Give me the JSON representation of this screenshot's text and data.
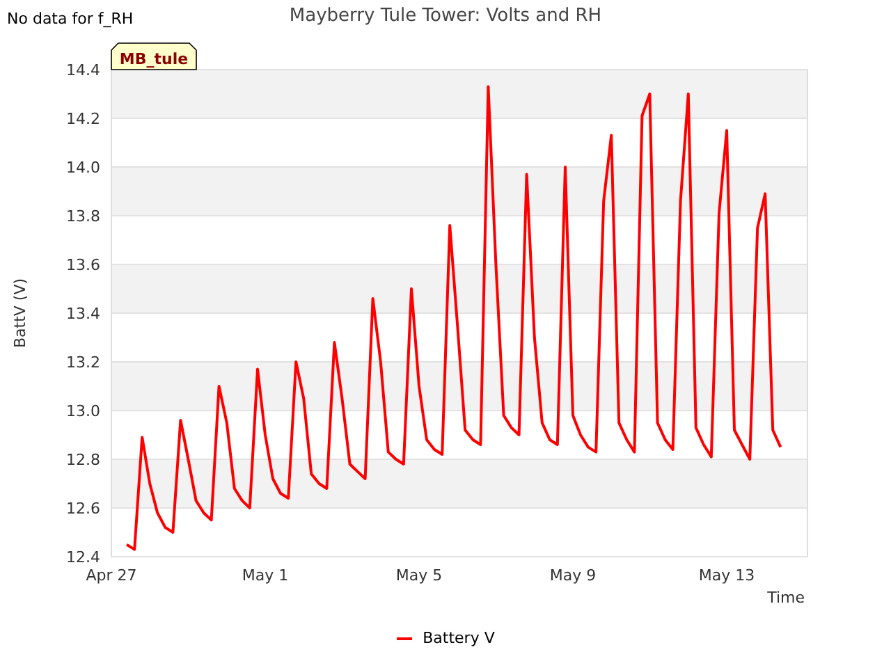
{
  "notice": "No data for f_RH",
  "title": "Mayberry Tule Tower: Volts and RH",
  "station_tag": "MB_tule",
  "chart_data": {
    "type": "line",
    "xlabel": "Time",
    "ylabel": "BattV (V)",
    "grid": true,
    "ylim": [
      12.4,
      14.4
    ],
    "yticks": [
      12.4,
      12.6,
      12.8,
      {
        "value": 13,
        "label": "13.0"
      },
      13.2,
      13.4,
      13.6,
      13.8,
      {
        "value": 14,
        "label": "14.0"
      },
      14.2,
      14.4
    ],
    "categories": [
      "Apr 27",
      null,
      null,
      null,
      null,
      null,
      null,
      null,
      null,
      null,
      null,
      null,
      null,
      null,
      null,
      null,
      null,
      null,
      null,
      null,
      "May 1",
      null,
      null,
      null,
      null,
      null,
      null,
      null,
      null,
      null,
      null,
      null,
      null,
      null,
      null,
      null,
      null,
      null,
      null,
      null,
      "May 5",
      null,
      null,
      null,
      null,
      null,
      null,
      null,
      null,
      null,
      null,
      null,
      null,
      null,
      null,
      null,
      null,
      null,
      null,
      null,
      "May 9",
      null,
      null,
      null,
      null,
      null,
      null,
      null,
      null,
      null,
      null,
      null,
      null,
      null,
      null,
      null,
      null,
      null,
      null,
      null,
      "May 13",
      null,
      null,
      null,
      null,
      null,
      null,
      null
    ],
    "series": [
      {
        "name": "Battery V",
        "color": "#ff0000",
        "values": [
          null,
          null,
          12.45,
          12.43,
          12.89,
          12.7,
          12.58,
          12.52,
          12.5,
          12.96,
          12.8,
          12.63,
          12.58,
          12.55,
          13.1,
          12.95,
          12.68,
          12.63,
          12.6,
          13.17,
          12.9,
          12.72,
          12.66,
          12.64,
          13.2,
          13.05,
          12.74,
          12.7,
          12.68,
          13.28,
          13.05,
          12.78,
          12.75,
          12.72,
          13.46,
          13.2,
          12.83,
          12.8,
          12.78,
          13.5,
          13.1,
          12.88,
          12.84,
          12.82,
          13.76,
          13.35,
          12.92,
          12.88,
          12.86,
          14.33,
          13.6,
          12.98,
          12.93,
          12.9,
          13.97,
          13.3,
          12.95,
          12.88,
          12.86,
          14.0,
          12.98,
          12.9,
          12.85,
          12.83,
          13.86,
          14.13,
          12.95,
          12.88,
          12.83,
          14.21,
          14.3,
          12.95,
          12.88,
          12.84,
          13.86,
          14.3,
          12.93,
          12.86,
          12.81,
          13.81,
          14.15,
          12.92,
          12.86,
          12.8,
          13.75,
          13.89,
          12.92,
          12.85
        ]
      }
    ]
  }
}
